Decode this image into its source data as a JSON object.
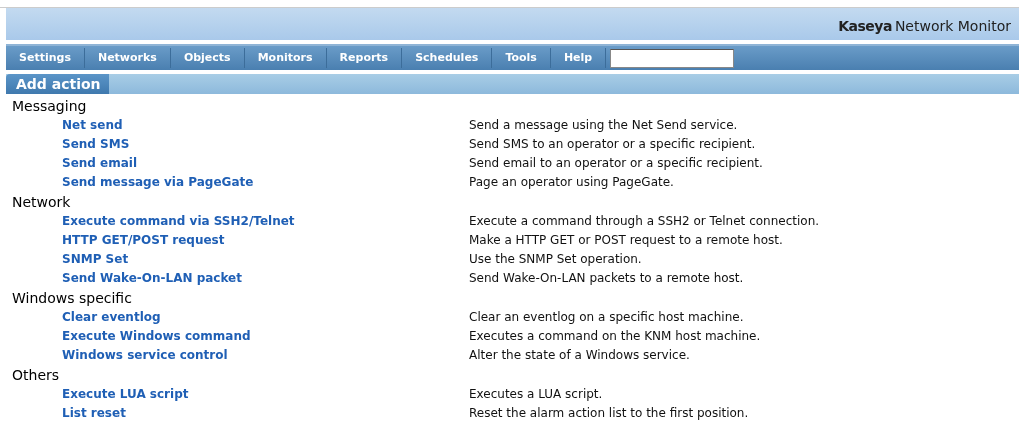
{
  "brand": {
    "logo_text": "Kaseya",
    "product": "Network Monitor"
  },
  "menu": [
    {
      "label": "Settings"
    },
    {
      "label": "Networks"
    },
    {
      "label": "Objects"
    },
    {
      "label": "Monitors"
    },
    {
      "label": "Reports"
    },
    {
      "label": "Schedules"
    },
    {
      "label": "Tools"
    },
    {
      "label": "Help"
    }
  ],
  "section_title": "Add action",
  "groups": [
    {
      "title": "Messaging",
      "actions": [
        {
          "name": "Net send",
          "description": "Send a message using the Net Send service."
        },
        {
          "name": "Send SMS",
          "description": "Send SMS to an operator or a specific recipient."
        },
        {
          "name": "Send email",
          "description": "Send email to an operator or a specific recipient."
        },
        {
          "name": "Send message via PageGate",
          "description": "Page an operator using PageGate."
        }
      ]
    },
    {
      "title": "Network",
      "actions": [
        {
          "name": "Execute command via SSH2/Telnet",
          "description": "Execute a command through a SSH2 or Telnet connection."
        },
        {
          "name": "HTTP GET/POST request",
          "description": "Make a HTTP GET or POST request to a remote host."
        },
        {
          "name": "SNMP Set",
          "description": "Use the SNMP Set operation."
        },
        {
          "name": "Send Wake-On-LAN packet",
          "description": "Send Wake-On-LAN packets to a remote host."
        }
      ]
    },
    {
      "title": "Windows specific",
      "actions": [
        {
          "name": "Clear eventlog",
          "description": "Clear an eventlog on a specific host machine."
        },
        {
          "name": "Execute Windows command",
          "description": "Executes a command on the KNM host machine."
        },
        {
          "name": "Windows service control",
          "description": "Alter the state of a Windows service."
        }
      ]
    },
    {
      "title": "Others",
      "actions": [
        {
          "name": "Execute LUA script",
          "description": "Executes a LUA script."
        },
        {
          "name": "List reset",
          "description": "Reset the alarm action list to the first position."
        }
      ]
    }
  ]
}
